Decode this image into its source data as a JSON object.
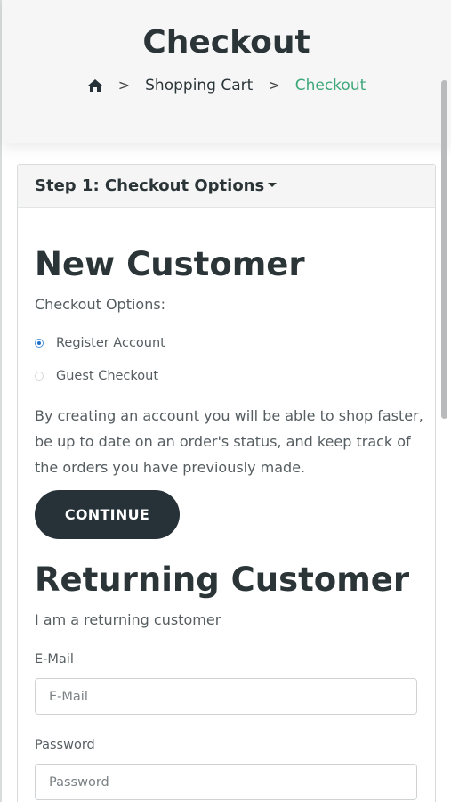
{
  "header": {
    "title": "Checkout",
    "breadcrumb": {
      "home_icon": "home-icon",
      "separator": ">",
      "items": [
        "Shopping Cart",
        "Checkout"
      ]
    }
  },
  "step1": {
    "title": "Step 1: Checkout Options"
  },
  "new_customer": {
    "heading": "New Customer",
    "options_label": "Checkout Options:",
    "options": [
      {
        "label": "Register Account",
        "checked": true
      },
      {
        "label": "Guest Checkout",
        "checked": false
      }
    ],
    "description": "By creating an account you will be able to shop faster, be up to date on an order's status, and keep track of the orders you have previously made.",
    "continue_label": "CONTINUE"
  },
  "returning_customer": {
    "heading": "Returning Customer",
    "subtitle": "I am a returning customer",
    "email_label": "E-Mail",
    "email_placeholder": "E-Mail",
    "password_label": "Password",
    "password_placeholder": "Password"
  },
  "colors": {
    "accent": "#3ea87a",
    "button_bg": "#263238",
    "radio_selected": "#1e6fc8"
  }
}
